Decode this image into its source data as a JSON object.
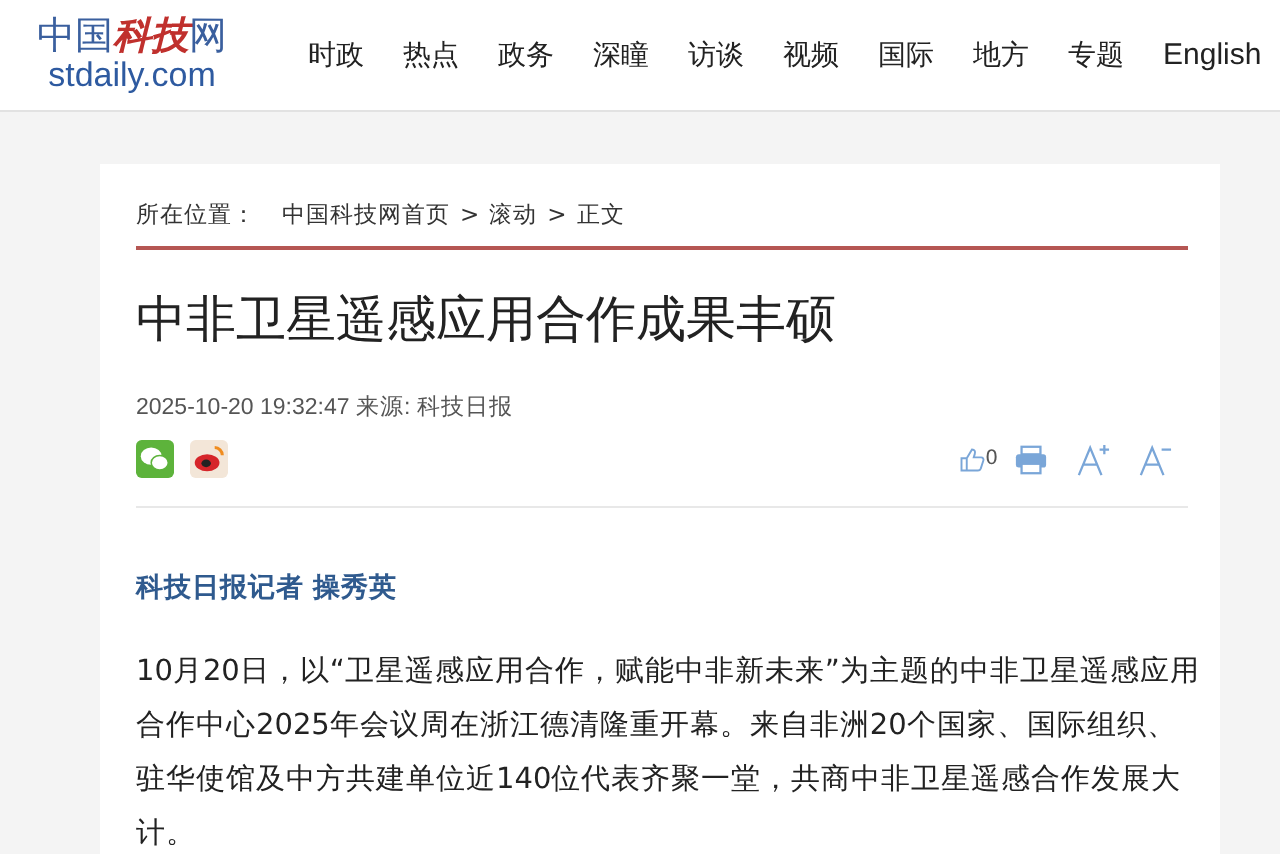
{
  "logo": {
    "name_parts": [
      {
        "text": "中国",
        "kind": "plain"
      },
      {
        "text": "科技",
        "kind": "script"
      },
      {
        "text": "网",
        "kind": "plain"
      }
    ],
    "domain": "stdaily.com"
  },
  "nav": [
    {
      "label": "时政"
    },
    {
      "label": "热点"
    },
    {
      "label": "政务"
    },
    {
      "label": "深瞳"
    },
    {
      "label": "访谈"
    },
    {
      "label": "视频"
    },
    {
      "label": "国际"
    },
    {
      "label": "地方"
    },
    {
      "label": "专题"
    },
    {
      "label": "English"
    }
  ],
  "breadcrumb": {
    "prefix": "所在位置：",
    "items": [
      "中国科技网首页",
      "滚动",
      "正文"
    ],
    "separator": ">"
  },
  "article": {
    "title": "中非卫星遥感应用合作成果丰硕",
    "meta": "2025-10-20 19:32:47 来源: 科技日报",
    "share": [
      {
        "kind": "wechat"
      },
      {
        "kind": "weibo"
      }
    ],
    "tools": [
      {
        "kind": "like",
        "count": "0"
      },
      {
        "kind": "print"
      },
      {
        "kind": "font-up"
      },
      {
        "kind": "font-down"
      }
    ],
    "byline": "科技日报记者 操秀英",
    "paragraphs": [
      "10月20日，以“卫星遥感应用合作，赋能中非新未来”为主题的中非卫星遥感应用合作中心2025年会议周在浙江德清隆重开幕。来自非洲20个国家、国际组织、驻华使馆及中方共建单位近140位代表齐聚一堂，共商中非卫星遥感合作发展大计。"
    ]
  }
}
